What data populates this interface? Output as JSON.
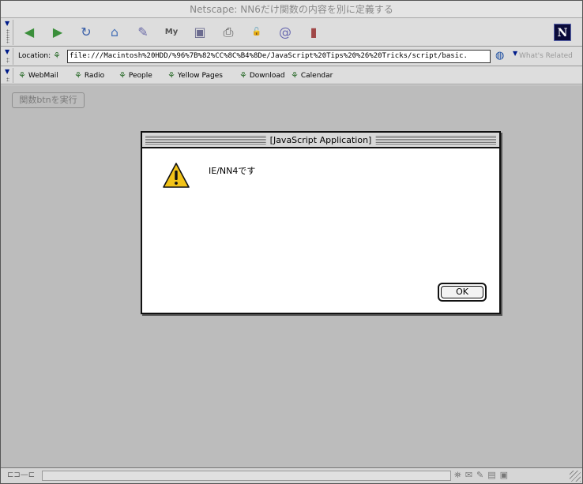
{
  "window": {
    "title": "Netscape: NN6だけ関数の内容を別に定義する"
  },
  "nav_toolbar": {
    "buttons": [
      {
        "name": "back-button",
        "icon": "back-arrow-icon",
        "glyph": "◀",
        "color": "#3b8f3b"
      },
      {
        "name": "forward-button",
        "icon": "forward-arrow-icon",
        "glyph": "▶",
        "color": "#3b8f3b"
      },
      {
        "name": "reload-button",
        "icon": "reload-icon",
        "glyph": "↻",
        "color": "#3a5fa8"
      },
      {
        "name": "home-button",
        "icon": "home-icon",
        "glyph": "⌂",
        "color": "#4a74b8"
      },
      {
        "name": "search-button",
        "icon": "search-icon",
        "glyph": "✎",
        "color": "#6a6aa8"
      },
      {
        "name": "my-netscape-button",
        "icon": "my-netscape-icon",
        "glyph": "My",
        "color": "#555555"
      },
      {
        "name": "images-button",
        "icon": "images-icon",
        "glyph": "▣",
        "color": "#6b6b8f"
      },
      {
        "name": "print-button",
        "icon": "print-icon",
        "glyph": "⎙",
        "color": "#555555"
      },
      {
        "name": "security-button",
        "icon": "security-lock-icon",
        "glyph": "🔓",
        "color": "#b03030"
      },
      {
        "name": "shop-button",
        "icon": "shop-icon",
        "glyph": "@",
        "color": "#6a6ab0"
      },
      {
        "name": "stop-button",
        "icon": "stop-icon",
        "glyph": "▮",
        "color": "#a04848"
      }
    ],
    "brand_glyph": "N"
  },
  "location_bar": {
    "label": "Location:",
    "url": "file:///Macintosh%20HDD/%96%7B%82%CC%8C%B4%8De/JavaScript%20Tips%20%26%20Tricks/script/basic.",
    "related_label": "What's Related"
  },
  "personal_toolbar": {
    "items": [
      {
        "label": "WebMail"
      },
      {
        "label": "Radio"
      },
      {
        "label": "People"
      },
      {
        "label": "Yellow Pages"
      },
      {
        "label": "Download"
      },
      {
        "label": "Calendar"
      }
    ]
  },
  "page": {
    "button_label": "関数btnを実行"
  },
  "dialog": {
    "title": "[JavaScript Application]",
    "message": "IE/NN4です",
    "ok_label": "OK",
    "icon": "warning-icon",
    "icon_color": "#f2c318"
  },
  "colors": {
    "content_background": "#bcbcbc",
    "chrome_background": "#dddddd",
    "toolbar_handle": "#001c8a"
  }
}
